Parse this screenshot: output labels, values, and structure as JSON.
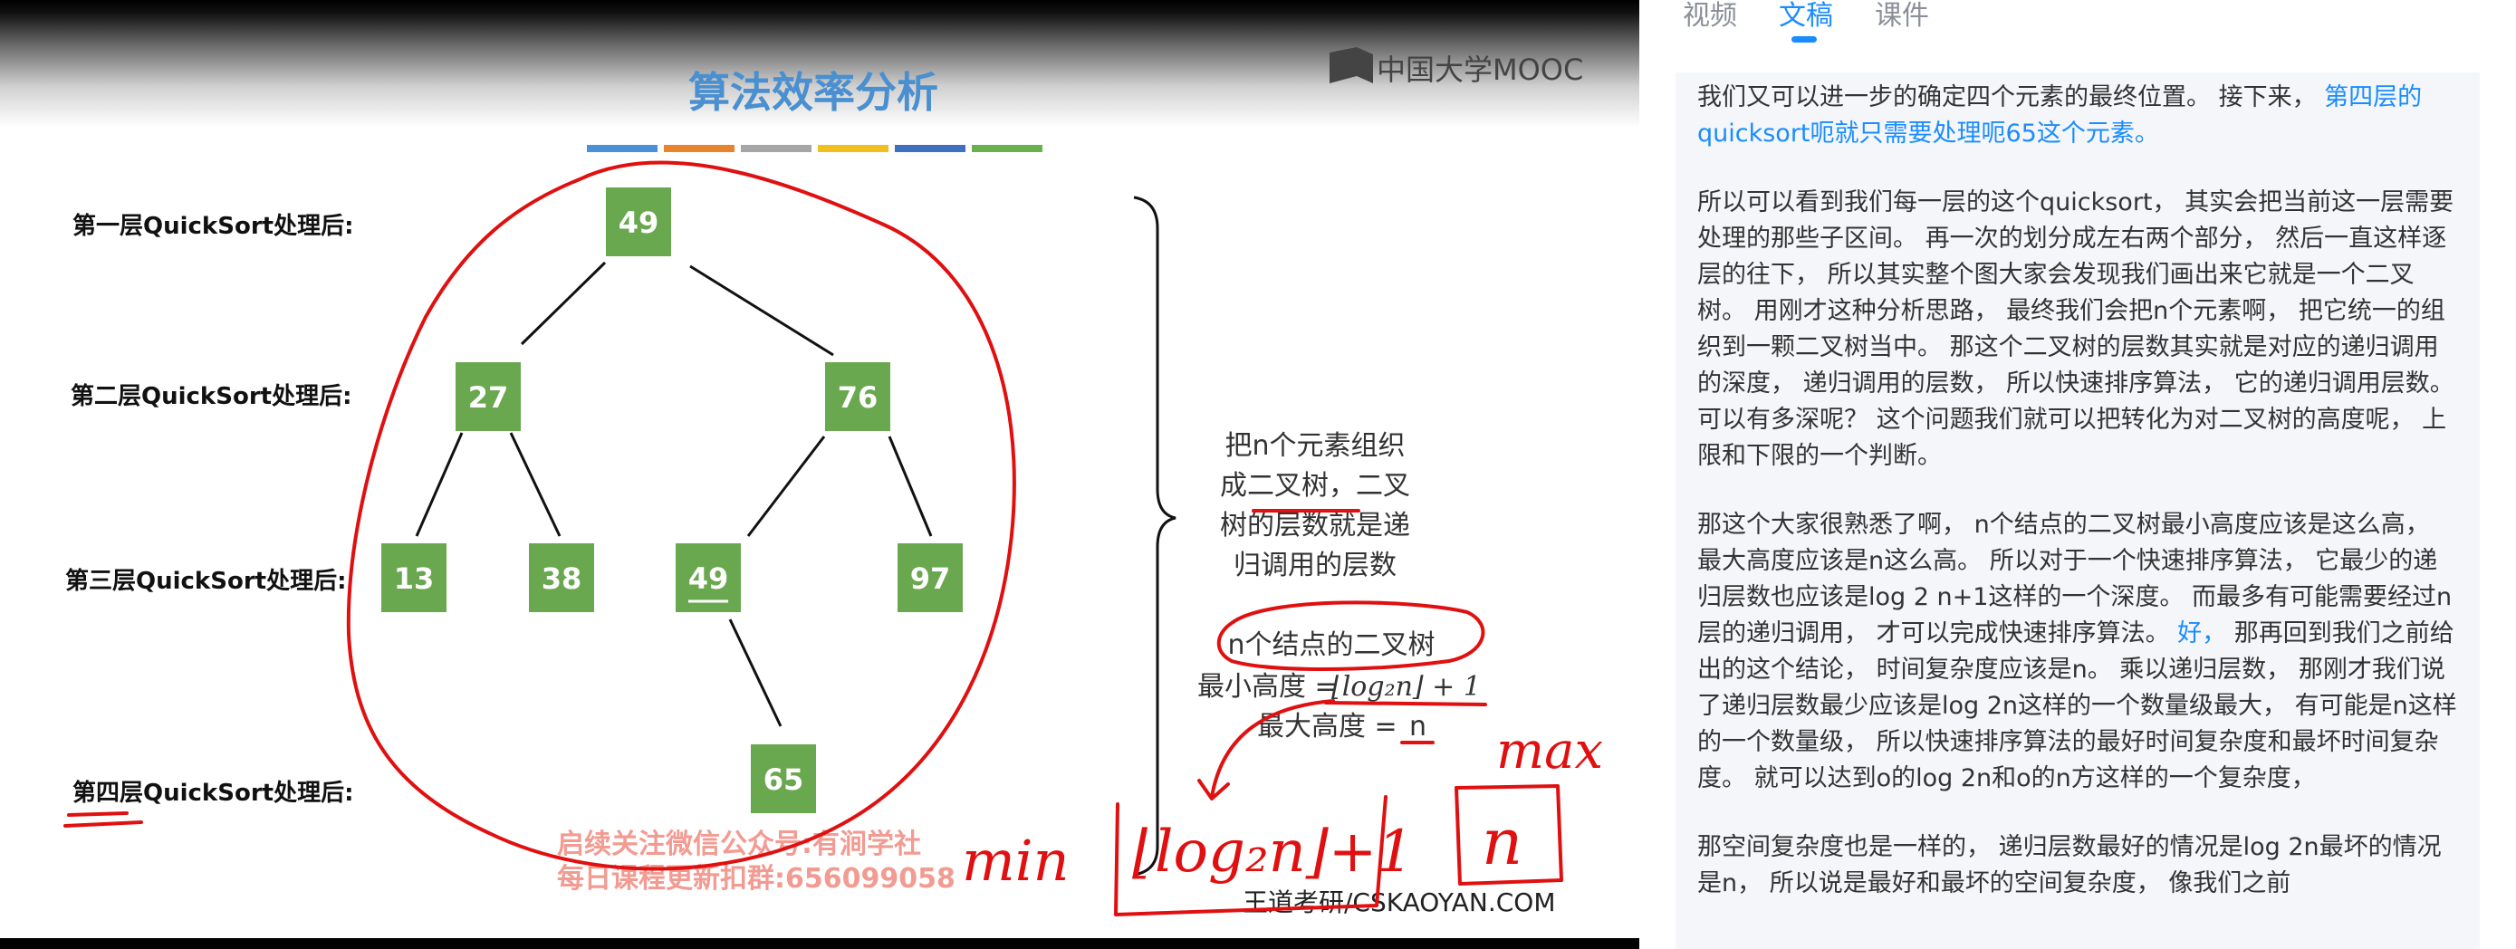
{
  "slide": {
    "title": "算法效率分析",
    "logo": "中国大学MOOC",
    "title_bar_colors": [
      "#4a90d9",
      "#e8842c",
      "#a6a6a6",
      "#f0c020",
      "#3f6fbf",
      "#6ab04c"
    ],
    "node_color": "#6aa84f",
    "levels": [
      "第一层QuickSort处理后:",
      "第二层QuickSort处理后:",
      "第三层QuickSort处理后:",
      "第四层QuickSort处理后:"
    ],
    "nodes": [
      "49",
      "27",
      "76",
      "13",
      "38",
      "49",
      "97",
      "65"
    ],
    "side_note": [
      "把n个元素组织",
      "成二叉树，二叉",
      "树的层数就是递",
      "归调用的层数"
    ],
    "node_tree_label": "n个结点的二叉树",
    "min_height_label": "最小高度 = ",
    "min_height_formula": "⌊log₂n⌋ + 1",
    "max_height_label": "最大高度 = ",
    "max_height_value": "n",
    "watermark": [
      "启续关注微信公众号:有涧学社",
      "每日课程更新扣群:656099058"
    ],
    "footer": "王道考研/CSKAOYAN.COM",
    "handwriting": {
      "min": "min",
      "max": "max",
      "min_formula": "⌊log₂n⌋+1",
      "max_value": "n"
    }
  },
  "panel": {
    "tabs": [
      "视频",
      "文稿",
      "课件"
    ],
    "active_tab": "文稿",
    "paragraphs": [
      {
        "normal": "我们又可以进一步的确定四个元素的最终位置。 接下来， ",
        "highlight": "第四层的quicksort呃就只需要处理呃65这个元素。"
      },
      {
        "normal": "所以可以看到我们每一层的这个quicksort， 其实会把当前这一层需要处理的那些子区间。 再一次的划分成左右两个部分， 然后一直这样逐层的往下， 所以其实整个图大家会发现我们画出来它就是一个二叉树。 用刚才这种分析思路， 最终我们会把n个元素啊， 把它统一的组织到一颗二叉树当中。 那这个二叉树的层数其实就是对应的递归调用的深度， 递归调用的层数， 所以快速排序算法， 它的递归调用层数。 可以有多深呢？ 这个问题我们就可以把转化为对二叉树的高度呢， 上限和下限的一个判断。"
      },
      {
        "normal": "那这个大家很熟悉了啊， n个结点的二叉树最小高度应该是这么高， 最大高度应该是n这么高。 所以对于一个快速排序算法， 它最少的递归层数也应该是log 2 n+1这样的一个深度。 而最多有可能需要经过n层的递归调用， 才可以完成快速排序算法。 ",
        "highlight": "好，",
        "tail": " 那再回到我们之前给出的这个结论， 时间复杂度应该是n。 乘以递归层数， 那刚才我们说了递归层数最少应该是log 2n这样的一个数量级最大， 有可能是n这样的一个数量级， 所以快速排序算法的最好时间复杂度和最坏时间复杂度。 就可以达到o的log 2n和o的n方这样的一个复杂度，"
      },
      {
        "normal": "那空间复杂度也是一样的， 递归层数最好的情况是log 2n最坏的情况是n， 所以说是最好和最坏的空间复杂度， 像我们之前"
      }
    ]
  }
}
